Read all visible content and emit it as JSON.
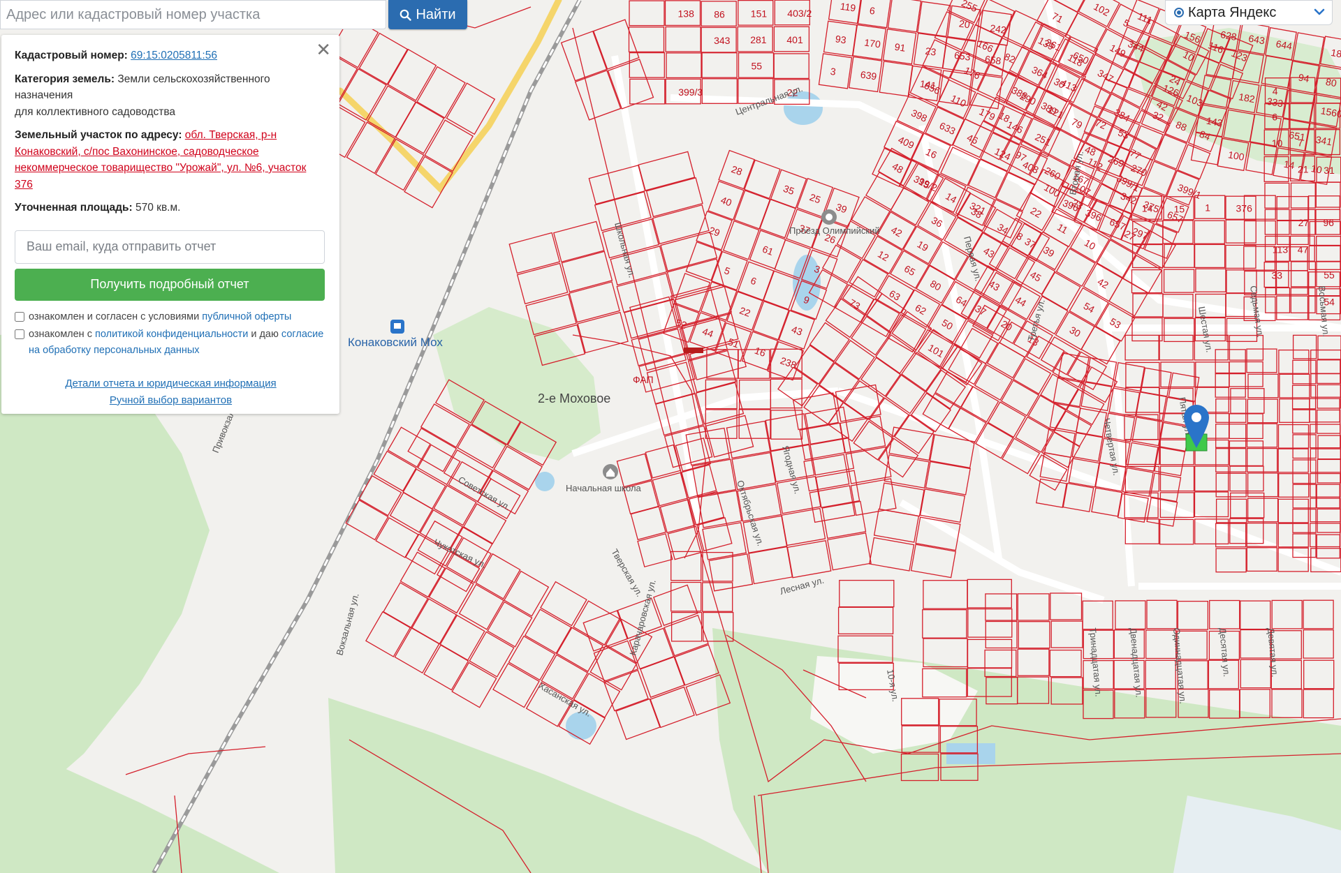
{
  "search": {
    "placeholder": "Адрес или кадастровый номер участка",
    "button_label": "Найти"
  },
  "map_switch": {
    "label": "Карта Яндекс"
  },
  "panel": {
    "cadastral_label": "Кадастровый номер:",
    "cadastral_number": "69:15:0205811:56",
    "category_label": "Категория земель:",
    "category_value": "Земли сельскохозяйственного назначения",
    "usage_value": "для коллективного садоводства",
    "address_label": "Земельный участок по адресу:",
    "address_value": "обл. Тверская, р-н Конаковский, с/пос Вахонинское, садоводческое некоммерческое товарищество \"Урожай\", ул. №6, участок 376",
    "area_label": "Уточненная площадь:",
    "area_value": "570 кв.м.",
    "email_placeholder": "Ваш email, куда отправить отчет",
    "report_button": "Получить подробный отчет",
    "check1_prefix": "ознакомлен и согласен с условиями",
    "check1_link": "публичной оферты",
    "check2_prefix": "ознакомлен с",
    "check2_link": "политикой конфиденциальности",
    "check2_mid": "и даю",
    "check2_link2": "согласие на обработку персональных данных",
    "details_link": "Детали отчета и юридическая информация",
    "manual_link": "Ручной выбор вариантов"
  },
  "map": {
    "place_labels": [
      "2-е Моховое",
      "Конаковский Мох",
      "Начальная школа",
      "ФАП",
      "Проезд Олимпийский"
    ],
    "street_labels": [
      "Центральная ул.",
      "Школьная ул.",
      "Советская ул.",
      "Чукотская ул.",
      "Тверская ул.",
      "Октябрьская ул.",
      "Ягодная ул.",
      "Лесная ул.",
      "Вокзальная ул.",
      "Хасанская ул.",
      "Карачаровская ул.",
      "Пятая ул.",
      "Четвертая ул.",
      "Шестая ул.",
      "Седьмая ул.",
      "Восьмая ул.",
      "Десятая ул.",
      "Девятая ул.",
      "Двенадцатая ул.",
      "Одиннадцатая ул.",
      "Тринадцатая ул.",
      "Первая ул.",
      "Третья ул.",
      "Вторая ул.",
      "Привокзальная ул.",
      "10-я ул."
    ],
    "parcel_labels": [
      "138",
      "86",
      "151",
      "403/2",
      "343",
      "281",
      "401",
      "55",
      "399/3",
      "22",
      "119",
      "6",
      "20",
      "242",
      "93",
      "170",
      "91",
      "23",
      "653",
      "658",
      "3",
      "639",
      "141",
      "255",
      "261",
      "650",
      "166",
      "82",
      "364",
      "413",
      "176",
      "290",
      "121",
      "656",
      "110",
      "179",
      "146",
      "251",
      "398",
      "633",
      "46",
      "124",
      "408",
      "409",
      "16",
      "399/2",
      "321",
      "87",
      "102",
      "5",
      "10",
      "71",
      "149",
      "24",
      "139",
      "118",
      "347",
      "42",
      "30",
      "384",
      "388",
      "389",
      "79",
      "77",
      "18",
      "112",
      "399/1",
      "97",
      "260",
      "107",
      "111",
      "156",
      "116",
      "123",
      "344",
      "126",
      "103",
      "32",
      "88",
      "84",
      "72",
      "53",
      "48",
      "269",
      "270",
      "399/1",
      "167",
      "342",
      "375",
      "657",
      "396",
      "396",
      "657",
      "297",
      "628",
      "643",
      "644",
      "185",
      "94",
      "80",
      "182",
      "333",
      "1560/1",
      "143",
      "651",
      "341",
      "100",
      "14",
      "10",
      "4",
      "6",
      "10",
      "7",
      "21",
      "31",
      "27",
      "96",
      "113",
      "47",
      "33",
      "55",
      "54",
      "28",
      "35",
      "25",
      "39",
      "40",
      "37",
      "26",
      "29",
      "61",
      "3",
      "5",
      "6",
      "9",
      "22",
      "43",
      "52",
      "44",
      "51",
      "16",
      "238",
      "48",
      "15",
      "14",
      "38",
      "34",
      "37",
      "36",
      "43",
      "42",
      "19",
      "12",
      "65",
      "80",
      "64",
      "63",
      "62",
      "50",
      "73",
      "101",
      "100",
      "23",
      "27",
      "22",
      "11",
      "10",
      "8",
      "39",
      "42",
      "45",
      "54",
      "53",
      "43",
      "44",
      "30",
      "37",
      "20",
      "13",
      "14",
      "15",
      "1",
      "376"
    ]
  }
}
